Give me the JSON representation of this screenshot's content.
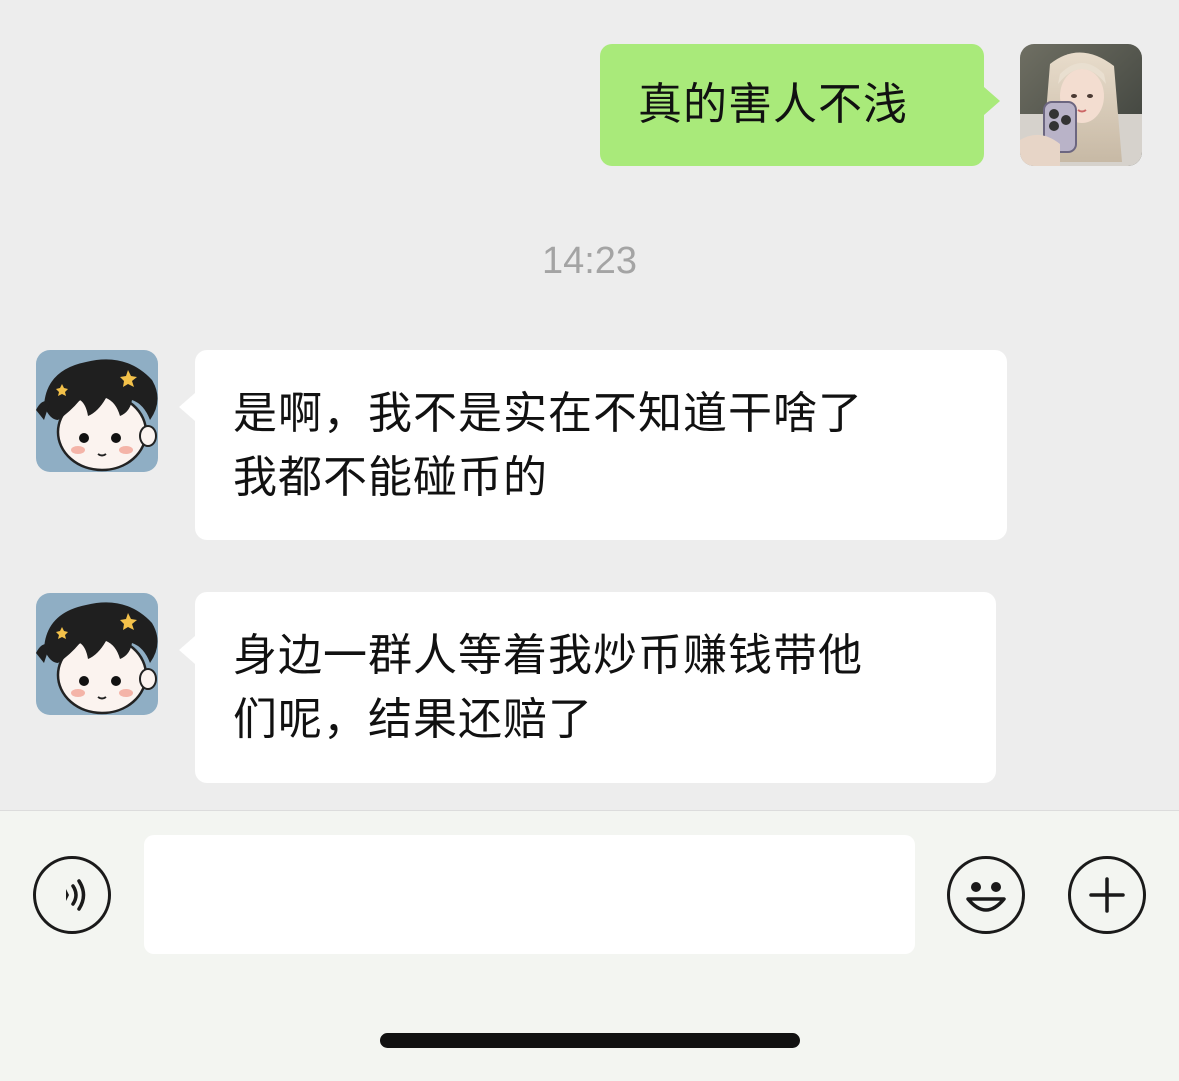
{
  "messages": [
    {
      "direction": "sent",
      "sender": "me",
      "lines": [
        "真的害人不浅"
      ]
    },
    {
      "direction": "recv",
      "sender": "friend",
      "lines": [
        "是啊，我不是实在不知道干啥了",
        "我都不能碰币的"
      ]
    },
    {
      "direction": "recv",
      "sender": "friend",
      "lines": [
        "身边一群人等着我炒币赚钱带他",
        "们呢，结果还赔了"
      ]
    }
  ],
  "timestamp": "14:23",
  "input": {
    "value": "",
    "placeholder": ""
  },
  "icons": {
    "voice": "voice-icon",
    "emoji": "emoji-icon",
    "plus": "plus-icon"
  },
  "colors": {
    "background": "#ededed",
    "sent_bubble": "#a9ea7a",
    "recv_bubble": "#ffffff",
    "timestamp": "#a4a4a4"
  }
}
